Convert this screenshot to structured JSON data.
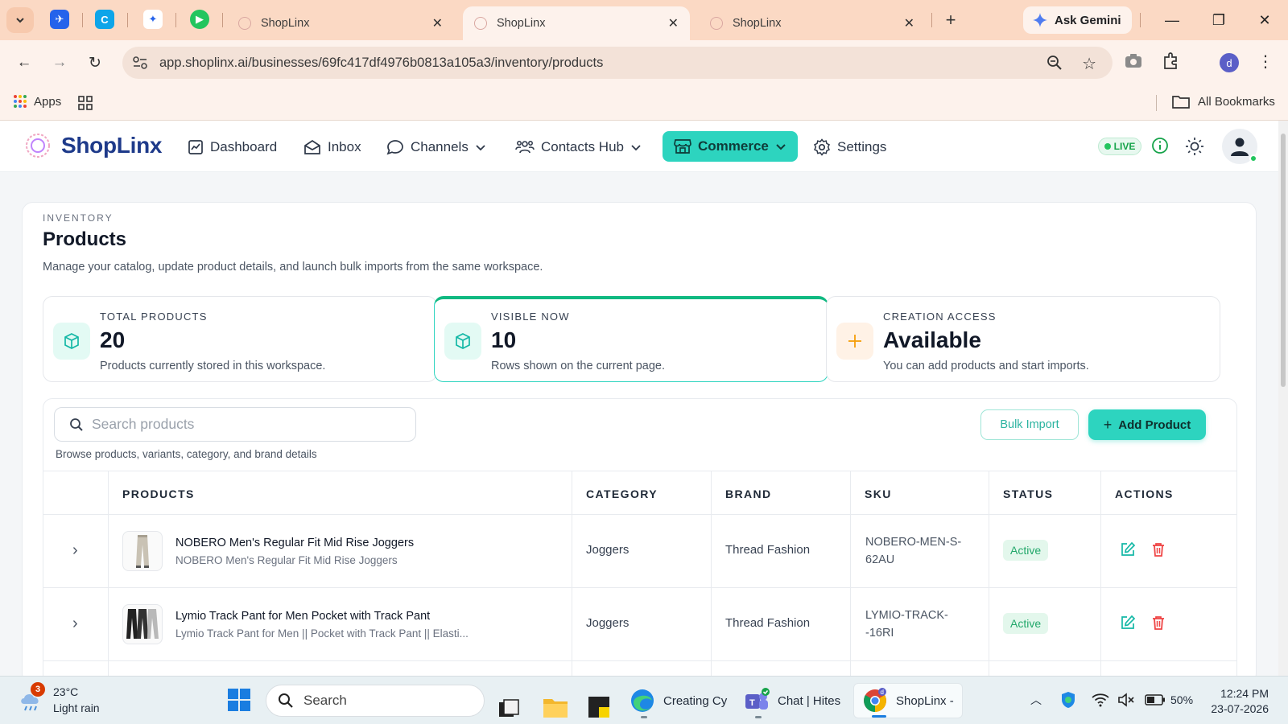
{
  "browser": {
    "tabs": [
      {
        "title": "ShopLinx",
        "active": false
      },
      {
        "title": "ShopLinx",
        "active": true
      },
      {
        "title": "ShopLinx",
        "active": false
      }
    ],
    "ask_gemini": "Ask Gemini",
    "url": "app.shoplinx.ai/businesses/69fc417df4976b0813a105a3/inventory/products",
    "profile_initial": "d",
    "bookmarks": {
      "apps": "Apps",
      "all": "All Bookmarks"
    }
  },
  "app": {
    "logo": "ShopLinx",
    "nav": {
      "dashboard": "Dashboard",
      "inbox": "Inbox",
      "channels": "Channels",
      "contacts": "Contacts Hub",
      "commerce": "Commerce",
      "settings": "Settings"
    },
    "live_badge": "LIVE",
    "accent": "#2dd4bf"
  },
  "page": {
    "eyebrow": "INVENTORY",
    "title": "Products",
    "subtitle": "Manage your catalog, update product details, and launch bulk imports from the same workspace."
  },
  "stats": [
    {
      "label": "TOTAL PRODUCTS",
      "value": "20",
      "desc": "Products currently stored in this workspace.",
      "icon": "box-icon"
    },
    {
      "label": "VISIBLE NOW",
      "value": "10",
      "desc": "Rows shown on the current page.",
      "icon": "box-icon"
    },
    {
      "label": "CREATION ACCESS",
      "value": "Available",
      "desc": "You can add products and start imports.",
      "icon": "plus-icon"
    }
  ],
  "toolbar": {
    "search_placeholder": "Search products",
    "search_help": "Browse products, variants, category, and brand details",
    "bulk_import": "Bulk Import",
    "add_product": "Add Product"
  },
  "table": {
    "headers": [
      "PRODUCTS",
      "CATEGORY",
      "BRAND",
      "SKU",
      "STATUS",
      "ACTIONS"
    ],
    "rows": [
      {
        "name": "NOBERO Men's Regular Fit Mid Rise Joggers",
        "desc": "NOBERO Men's Regular Fit Mid Rise Joggers",
        "category": "Joggers",
        "brand": "Thread Fashion",
        "sku_line1": "NOBERO-MEN-S-",
        "sku_line2": "62AU",
        "status": "Active"
      },
      {
        "name": "Lymio Track Pant for Men Pocket with Track Pant",
        "desc": "Lymio Track Pant for Men || Pocket with Track Pant || Elasti...",
        "category": "Joggers",
        "brand": "Thread Fashion",
        "sku_line1": "LYMIO-TRACK-",
        "sku_line2": "-16RI",
        "status": "Active"
      }
    ]
  },
  "taskbar": {
    "weather_badge": "3",
    "temp": "23°C",
    "condition": "Light rain",
    "search": "Search",
    "apps": {
      "edge": "Creating Cy",
      "teams": "Chat | Hites",
      "chrome": "ShopLinx -"
    },
    "battery": "50%",
    "time": "12:24 PM",
    "date": "23-07-2026"
  }
}
